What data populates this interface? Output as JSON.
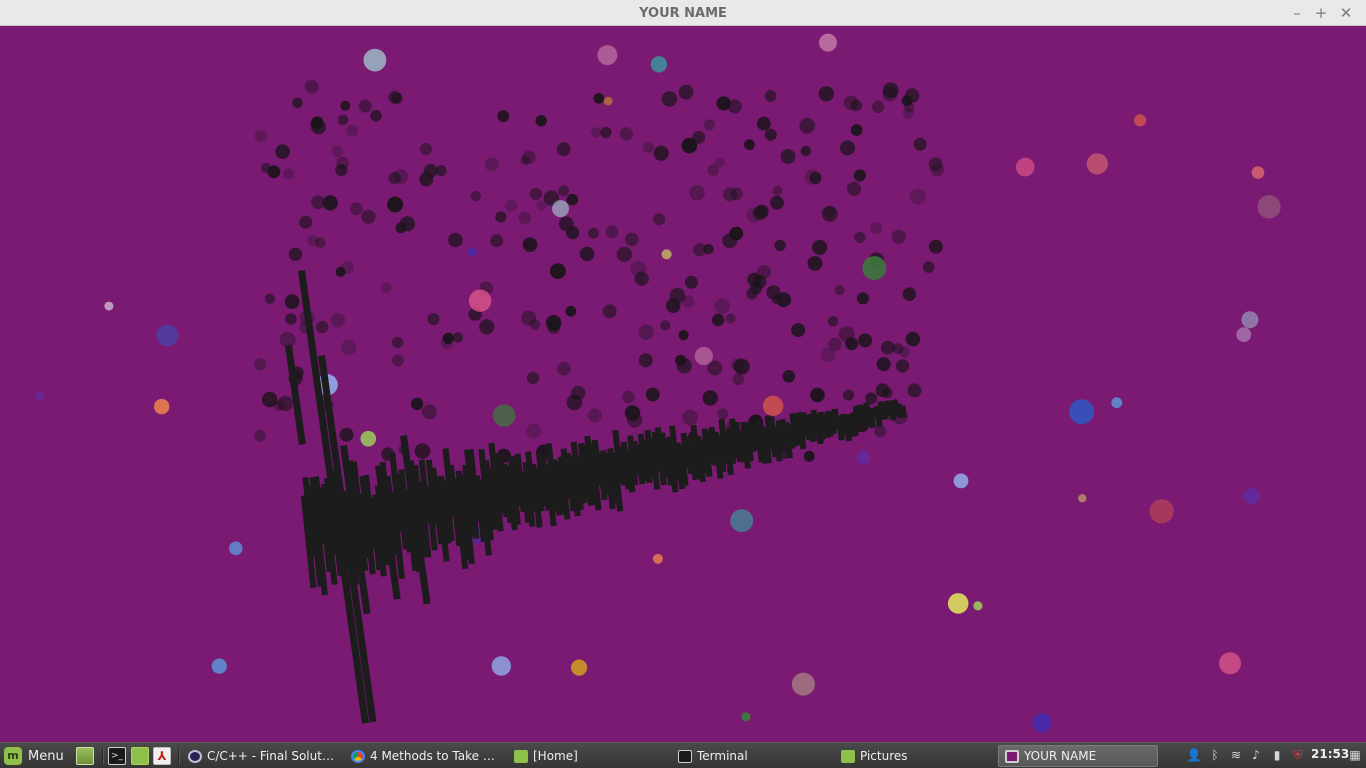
{
  "window": {
    "title": "YOUR NAME",
    "minimize_icon": "minimize-icon",
    "maximize_icon": "maximize-icon",
    "close_icon": "close-icon",
    "background_color": "#7a1a72"
  },
  "scene": {
    "description_colors": {
      "background": "#7a1a72",
      "waveform": "#1c1c1c"
    }
  },
  "taskbar": {
    "menu_label": "Menu",
    "menu_icon": "linux-mint-icon",
    "launchers": [
      {
        "name": "show-desktop-launcher",
        "icon": "desktop-icon"
      },
      {
        "name": "terminal-launcher",
        "icon": "terminal-icon"
      },
      {
        "name": "files-launcher",
        "icon": "folder-icon"
      },
      {
        "name": "pdf-reader-launcher",
        "icon": "pdf-icon"
      }
    ],
    "tasks": [
      {
        "label": "C/C++ - Final Solutio...",
        "icon": "eclipse-icon",
        "active": false
      },
      {
        "label": "4 Methods to Take S...",
        "icon": "chrome-icon",
        "active": false
      },
      {
        "label": "[Home]",
        "icon": "folder-icon",
        "active": false
      },
      {
        "label": "Terminal",
        "icon": "terminal-icon",
        "active": false
      },
      {
        "label": "Pictures",
        "icon": "folder-icon",
        "active": false
      },
      {
        "label": "YOUR NAME",
        "icon": "app-window-icon",
        "active": true
      }
    ],
    "tray": [
      "user-icon",
      "bluetooth-icon",
      "wifi-icon",
      "volume-icon",
      "battery-icon",
      "update-shield-icon"
    ],
    "clock": "21:53"
  }
}
